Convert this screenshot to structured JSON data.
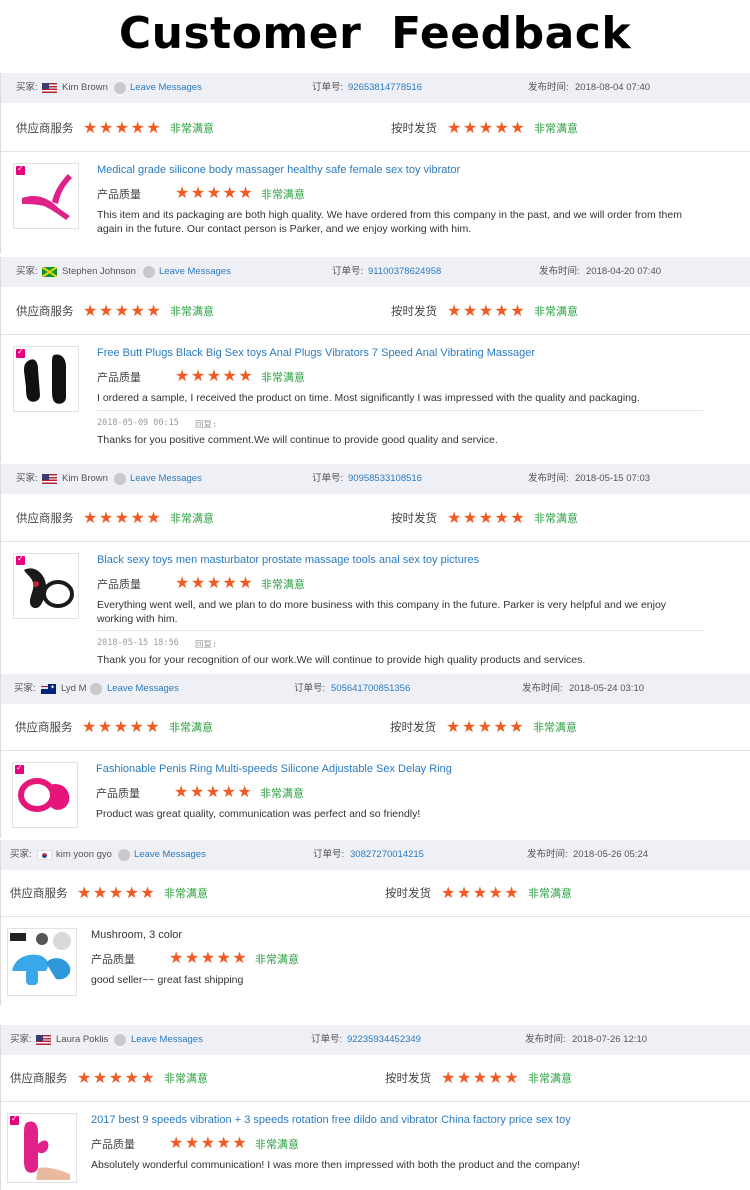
{
  "page_title": "Customer Feedback",
  "labels": {
    "buyer": "买家:",
    "order": "订单号:",
    "date": "发布时间:",
    "supplier_service": "供应商服务",
    "on_time_delivery": "按时发货",
    "product_quality": "产品质量",
    "very_satisfied": "非常满意",
    "leave_messages": "Leave Messages",
    "reply": "回复:",
    "stars": "★★★★★"
  },
  "reviews": [
    {
      "buyer": "Kim Brown",
      "flag": "us",
      "order_no": "92653814778516",
      "date": "2018-08-04 07:40",
      "product_title": "Medical grade silicone body massager healthy safe female sex toy vibrator",
      "review": "This item and its packaging are both high quality. We have ordered from this company in the past, and we will order from them again in the future. Our contact person is Parker, and we enjoy working with him."
    },
    {
      "buyer": "Stephen Johnson",
      "flag": "jm",
      "order_no": "91100378624958",
      "date": "2018-04-20 07:40",
      "product_title": "Free Butt Plugs Black Big Sex toys Anal Plugs Vibrators 7 Speed Anal Vibrating Massager",
      "review": "I ordered a sample, I received the product on time. Most significantly I was impressed with the quality and packaging.",
      "reply_date": "2018-05-09 00:15",
      "reply": "Thanks for you positive comment.We will continue to provide good quality and service."
    },
    {
      "buyer": "Kim Brown",
      "flag": "us",
      "order_no": "90958533108516",
      "date": "2018-05-15 07:03",
      "product_title": "Black sexy toys men masturbator prostate massage tools anal sex toy pictures",
      "review": "Everything went well, and we plan to do more business with this company in the future. Parker is very helpful and we enjoy working with him.",
      "reply_date": "2018-05-15 18:56",
      "reply": "Thank you for your recognition of our work.We will continue to provide high quality products and services."
    },
    {
      "buyer": "Lyd M",
      "flag": "au",
      "order_no": "505641700851356",
      "date": "2018-05-24 03:10",
      "product_title": "Fashionable Penis Ring Multi-speeds Silicone Adjustable Sex Delay Ring",
      "review": "Product was great quality, communication was perfect and so friendly!"
    },
    {
      "buyer": "kim yoon gyo",
      "flag": "kr",
      "order_no": "30827270014215",
      "date": "2018-05-26 05:24",
      "product_title": "Mushroom, 3 color",
      "review": "good seller~~ great fast shipping"
    },
    {
      "buyer": "Laura Poklis",
      "flag": "us",
      "order_no": "92235934452349",
      "date": "2018-07-26 12:10",
      "product_title": "2017 best 9 speeds vibration + 3 speeds rotation free dildo and vibrator China factory price sex toy",
      "review": "Absolutely wonderful communication! I was more then impressed with both the product and the company!"
    }
  ]
}
